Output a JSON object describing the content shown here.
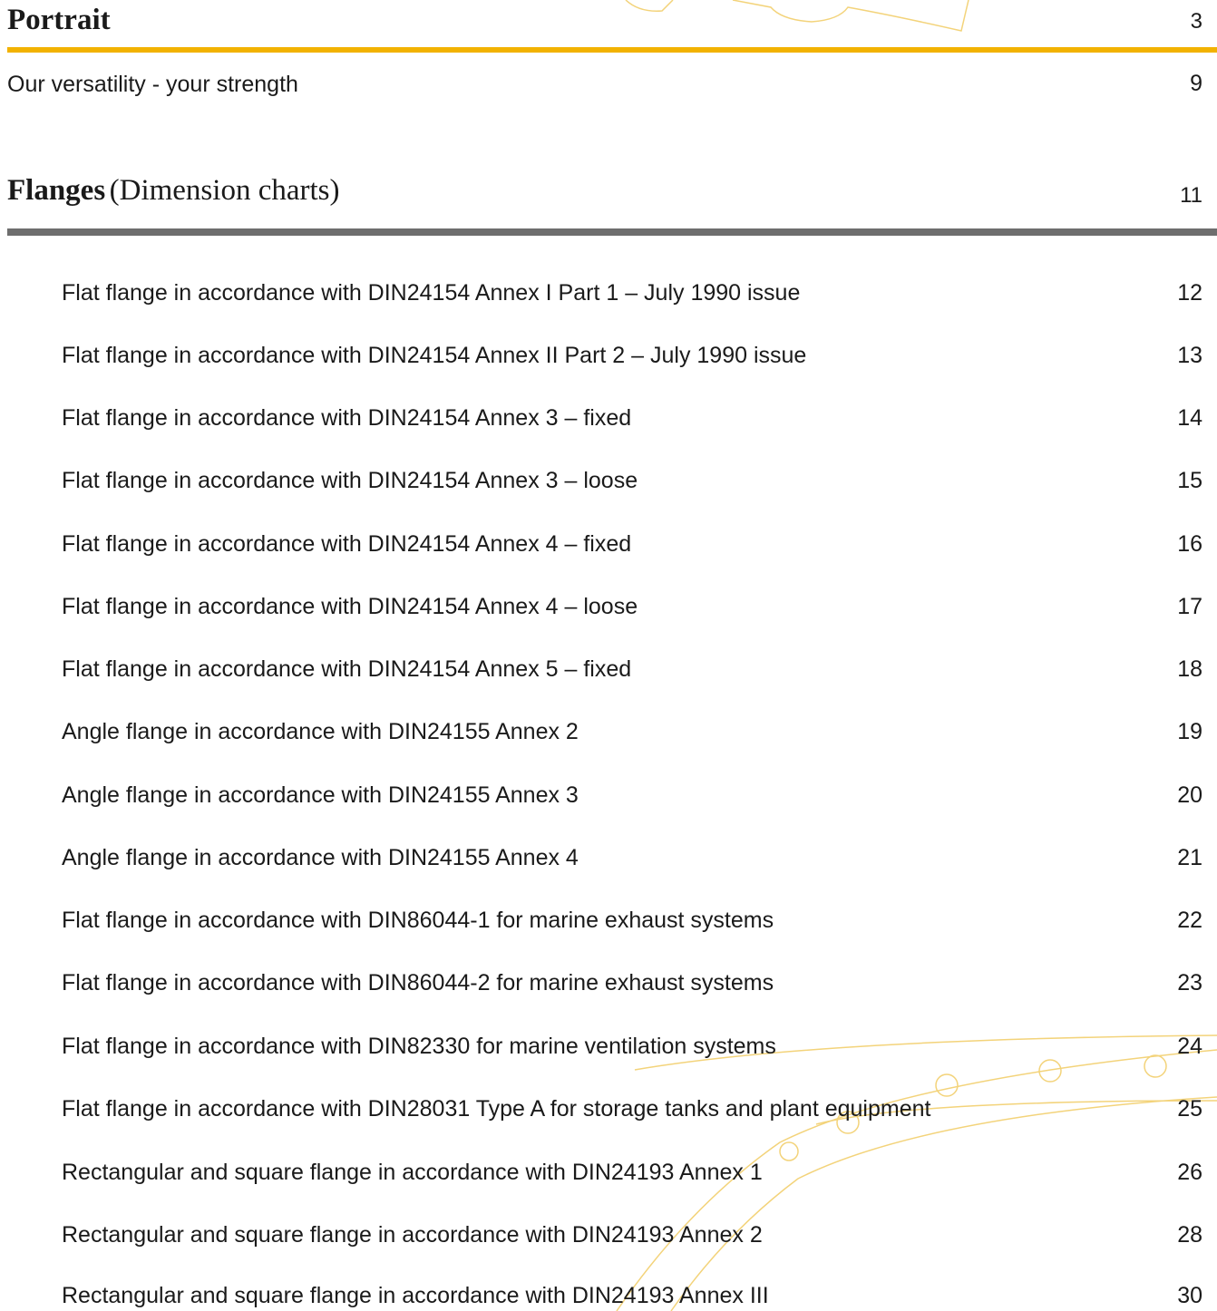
{
  "colors": {
    "accent": "#f2b200",
    "rule_gray": "#6e6e6e",
    "text": "#1a1a1a",
    "deco": "#f3d37a"
  },
  "portrait": {
    "title": "Portrait",
    "page": "3"
  },
  "intro": {
    "label": "Our versatility - your strength",
    "page": "9"
  },
  "flanges": {
    "title": "Flanges",
    "subtitle": "(Dimension charts)",
    "page": "11"
  },
  "entries": [
    {
      "label": "Flat flange in accordance with DIN24154 Annex I Part 1 – July 1990 issue",
      "page": "12"
    },
    {
      "label": "Flat flange in accordance with DIN24154 Annex II Part 2 – July 1990 issue",
      "page": "13"
    },
    {
      "label": "Flat flange in accordance with DIN24154 Annex 3 – fixed",
      "page": "14"
    },
    {
      "label": "Flat flange in accordance with DIN24154 Annex 3 – loose",
      "page": "15"
    },
    {
      "label": "Flat flange in accordance with DIN24154 Annex 4 – fixed",
      "page": "16"
    },
    {
      "label": "Flat flange in accordance with DIN24154 Annex 4 – loose",
      "page": "17"
    },
    {
      "label": "Flat flange in accordance with DIN24154 Annex 5 – fixed",
      "page": "18"
    },
    {
      "label": "Angle flange in accordance with DIN24155 Annex 2",
      "page": "19"
    },
    {
      "label": "Angle flange in accordance with DIN24155 Annex 3",
      "page": "20"
    },
    {
      "label": "Angle flange in accordance with DIN24155 Annex 4",
      "page": "21"
    },
    {
      "label": "Flat flange in accordance with DIN86044-1 for marine exhaust systems",
      "page": "22"
    },
    {
      "label": "Flat flange in accordance with DIN86044-2 for marine exhaust systems",
      "page": "23"
    },
    {
      "label": "Flat flange in accordance with DIN82330 for marine ventilation systems",
      "page": "24"
    },
    {
      "label": "Flat flange in accordance with DIN28031 Type A for storage tanks and plant equipment",
      "page": "25"
    },
    {
      "label": "Rectangular and square flange in accordance with DIN24193 Annex 1",
      "page": "26"
    },
    {
      "label": "Rectangular and square flange in accordance with DIN24193 Annex 2",
      "page": "28"
    },
    {
      "label": "Rectangular and square flange in accordance with DIN24193 Annex III",
      "page": "30"
    }
  ]
}
